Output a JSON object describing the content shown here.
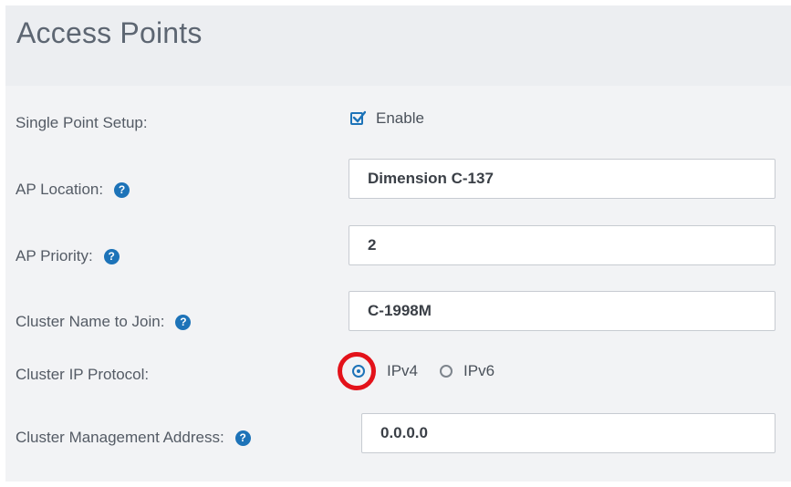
{
  "header": {
    "title": "Access Points"
  },
  "single_point_setup": {
    "label": "Single Point Setup:",
    "checkbox_label": "Enable",
    "checked": true
  },
  "ap_location": {
    "label": "AP Location:",
    "value": "Dimension C-137"
  },
  "ap_priority": {
    "label": "AP Priority:",
    "value": "2"
  },
  "cluster_name": {
    "label": "Cluster Name to Join:",
    "value": "C-1998M"
  },
  "cluster_ip_protocol": {
    "label": "Cluster IP Protocol:",
    "options": [
      {
        "label": "IPv4",
        "checked": true
      },
      {
        "label": "IPv6",
        "checked": false
      }
    ]
  },
  "cluster_management": {
    "label": "Cluster Management Address:",
    "value": "0.0.0.0"
  },
  "help_icon_glyph": "?",
  "colors": {
    "accent": "#1d73b8",
    "highlight": "#e3121a"
  }
}
